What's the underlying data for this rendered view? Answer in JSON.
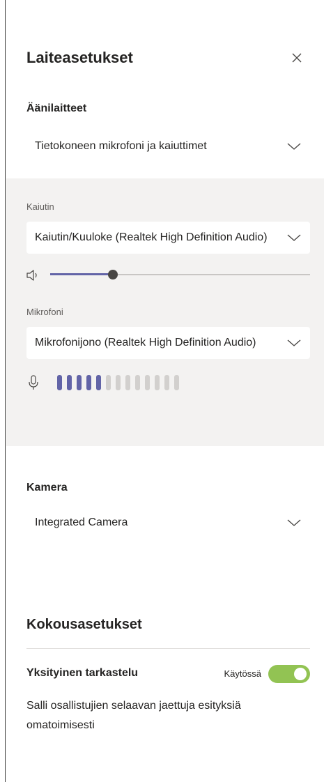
{
  "header": {
    "title": "Laiteasetukset"
  },
  "audio": {
    "label": "Äänilaitteet",
    "device": "Tietokoneen mikrofoni ja kaiuttimet"
  },
  "speaker": {
    "label": "Kaiutin",
    "device": "Kaiutin/Kuuloke (Realtek High Definition Audio)",
    "volume_percent": 24
  },
  "microphone": {
    "label": "Mikrofoni",
    "device": "Mikrofonijono (Realtek High Definition Audio)",
    "level_bars_total": 13,
    "level_bars_active": 5
  },
  "camera": {
    "label": "Kamera",
    "device": "Integrated Camera"
  },
  "meeting": {
    "title": "Kokousasetukset",
    "private_view_label": "Yksityinen tarkastelu",
    "private_view_state": "Käytössä",
    "private_view_enabled": true,
    "description": "Salli osallistujien selaavan jaettuja esityksiä omatoimisesti"
  },
  "colors": {
    "accent": "#6264a7",
    "toggle_on": "#92c353",
    "panel_gray": "#f3f2f1"
  },
  "icons": [
    "close-icon",
    "chevron-down-icon",
    "speaker-icon",
    "microphone-icon"
  ]
}
